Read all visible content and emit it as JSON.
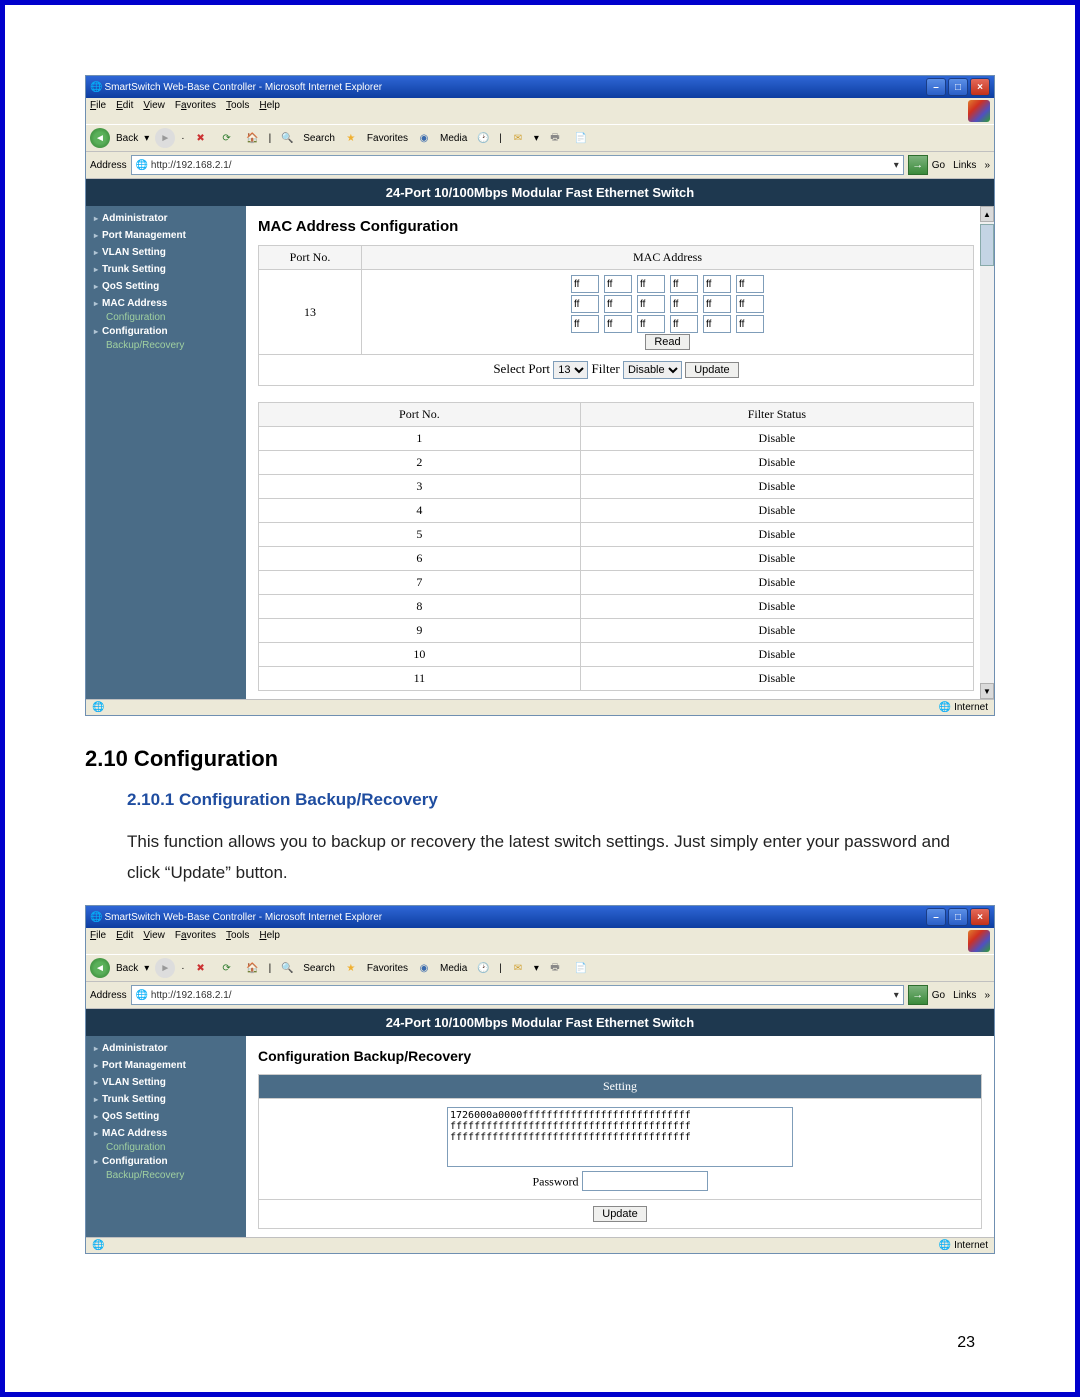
{
  "page_number": "23",
  "doc": {
    "heading_2_10": "2.10 Configuration",
    "heading_2_10_1": "2.10.1 Configuration Backup/Recovery",
    "paragraph": "This function allows you to backup or recovery the latest switch settings. Just simply enter your password and click “Update” button."
  },
  "browser": {
    "title": "SmartSwitch Web-Base Controller - Microsoft Internet Explorer",
    "menus": [
      "File",
      "Edit",
      "View",
      "Favorites",
      "Tools",
      "Help"
    ],
    "back": "Back",
    "search": "Search",
    "favorites": "Favorites",
    "media": "Media",
    "address_label": "Address",
    "address_url": "http://192.168.2.1/",
    "go": "Go",
    "links": "Links",
    "status_internet": "Internet"
  },
  "sidebar": {
    "items": [
      "Administrator",
      "Port Management",
      "VLAN Setting",
      "Trunk Setting",
      "QoS Setting",
      "MAC Address",
      "Configuration"
    ],
    "sub_items": [
      "Configuration",
      "Backup/Recovery"
    ]
  },
  "product_header": "24-Port 10/100Mbps Modular Fast Ethernet Switch",
  "screen1": {
    "title": "MAC Address Configuration",
    "portno_header": "Port No.",
    "mac_header": "MAC Address",
    "port_value": "13",
    "mac_default": "ff",
    "read_button": "Read",
    "select_port_label": "Select Port",
    "select_port_value": "13",
    "filter_label": "Filter",
    "filter_value": "Disable",
    "update_button": "Update",
    "status_header_port": "Port No.",
    "status_header_filter": "Filter Status",
    "rows": [
      {
        "port": "1",
        "status": "Disable"
      },
      {
        "port": "2",
        "status": "Disable"
      },
      {
        "port": "3",
        "status": "Disable"
      },
      {
        "port": "4",
        "status": "Disable"
      },
      {
        "port": "5",
        "status": "Disable"
      },
      {
        "port": "6",
        "status": "Disable"
      },
      {
        "port": "7",
        "status": "Disable"
      },
      {
        "port": "8",
        "status": "Disable"
      },
      {
        "port": "9",
        "status": "Disable"
      },
      {
        "port": "10",
        "status": "Disable"
      },
      {
        "port": "11",
        "status": "Disable"
      }
    ]
  },
  "screen2": {
    "title": "Configuration Backup/Recovery",
    "setting_header": "Setting",
    "textarea_value": "1726000a0000ffffffffffffffffffffffffffff\nffffffffffffffffffffffffffffffffffffffff\nffffffffffffffffffffffffffffffffffffffff",
    "password_label": "Password",
    "update_button": "Update"
  }
}
